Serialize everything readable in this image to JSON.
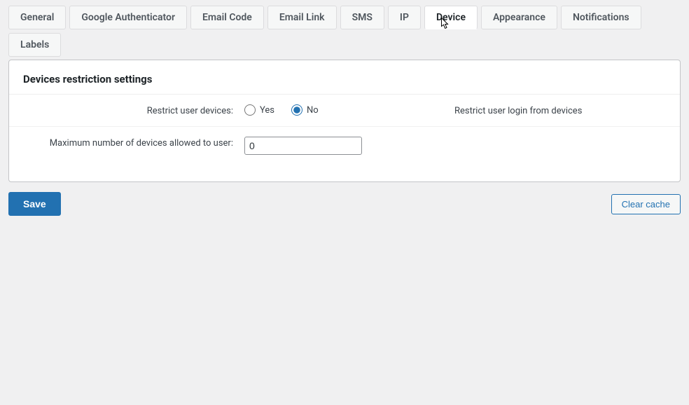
{
  "tabs": {
    "general": "General",
    "google_authenticator": "Google Authenticator",
    "email_code": "Email Code",
    "email_link": "Email Link",
    "sms": "SMS",
    "ip": "IP",
    "device": "Device",
    "appearance": "Appearance",
    "notifications": "Notifications",
    "labels": "Labels"
  },
  "section": {
    "title": "Devices restriction settings",
    "row1": {
      "label": "Restrict user devices:",
      "yes": "Yes",
      "no": "No",
      "desc": "Restrict user login from devices"
    },
    "row2": {
      "label": "Maximum number of devices allowed to user:",
      "value": "0"
    }
  },
  "buttons": {
    "save": "Save",
    "clear_cache": "Clear cache"
  }
}
